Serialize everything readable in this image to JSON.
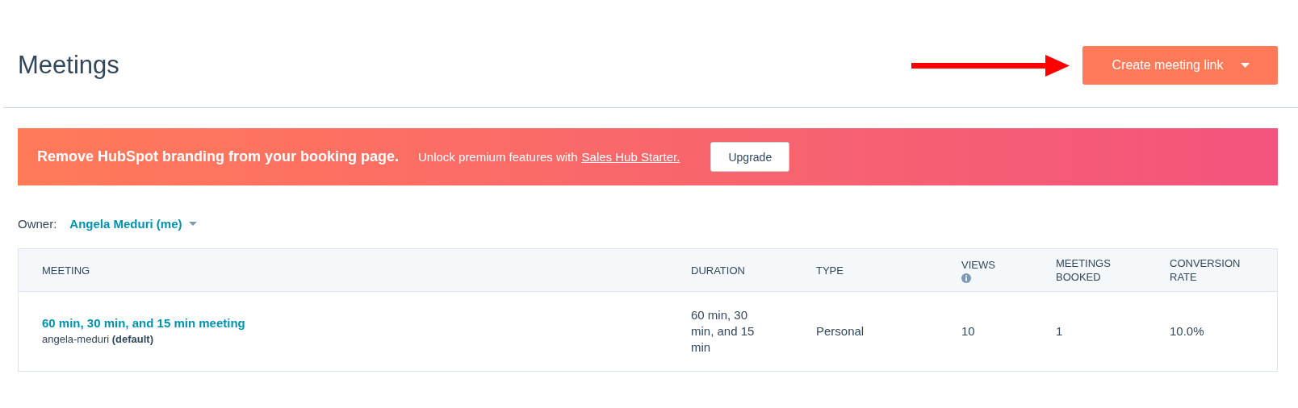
{
  "header": {
    "title": "Meetings",
    "create_button": "Create meeting link"
  },
  "banner": {
    "headline": "Remove HubSpot branding from your booking page.",
    "text": "Unlock premium features with",
    "link": "Sales Hub Starter.",
    "button": "Upgrade"
  },
  "owner_filter": {
    "label": "Owner:",
    "value": "Angela Meduri (me)"
  },
  "table": {
    "columns": [
      {
        "label": "MEETING",
        "info": false
      },
      {
        "label": "DURATION",
        "info": false
      },
      {
        "label": "TYPE",
        "info": false
      },
      {
        "label": "VIEWS",
        "info": true
      },
      {
        "label": "MEETINGS BOOKED",
        "info": false
      },
      {
        "label": "CONVERSION RATE",
        "info": false
      }
    ],
    "rows": [
      {
        "meeting": "60 min, 30 min, and 15 min meeting",
        "slug": "angela-meduri **(default)**",
        "duration": "60 min, 30 min, and 15 min",
        "type": "Personal",
        "views": "10",
        "meetings_booked": "1",
        "conversion_rate": "10.0%"
      }
    ]
  }
}
